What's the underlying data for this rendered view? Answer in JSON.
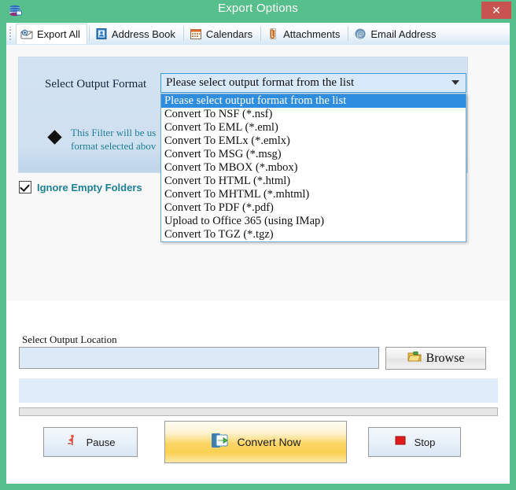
{
  "window": {
    "title": "Export Options",
    "app_icon": "database-stack-icon",
    "close_label": "✕",
    "titlebar_color": "#56bf8b",
    "close_button_color": "#c75450"
  },
  "tabs": [
    {
      "label": "Export All",
      "icon": "envelope-icon",
      "active": true
    },
    {
      "label": "Address Book",
      "icon": "contact-card-icon",
      "active": false
    },
    {
      "label": "Calendars",
      "icon": "calendar-icon",
      "active": false
    },
    {
      "label": "Attachments",
      "icon": "paperclip-icon",
      "active": false
    },
    {
      "label": "Email Address",
      "icon": "at-sign-icon",
      "active": false
    }
  ],
  "format_panel": {
    "label": "Select Output Format",
    "filter_note": "This Filter will be us format selected abov",
    "bullet_icon": "diamond-bullet-icon"
  },
  "combobox": {
    "value": "Please select output format from the list",
    "arrow_icon": "chevron-down-icon",
    "expanded": true,
    "selected_index": 0,
    "options": [
      "Please select output format from the list",
      "Convert To NSF (*.nsf)",
      "Convert To EML (*.eml)",
      "Convert To EMLx (*.emlx)",
      "Convert To MSG (*.msg)",
      "Convert To MBOX (*.mbox)",
      "Convert To HTML (*.html)",
      "Convert To MHTML (*.mhtml)",
      "Convert To PDF (*.pdf)",
      "Upload to Office 365 (using IMap)",
      "Convert To TGZ (*.tgz)"
    ],
    "highlight_color": "#2f8ddf"
  },
  "checkbox": {
    "label": "Ignore Empty Folders",
    "checked": true,
    "label_color": "#1d7f94"
  },
  "output_location": {
    "label": "Select Output Location",
    "value": "",
    "placeholder": "",
    "browse_label": "Browse",
    "browse_icon": "folder-open-icon"
  },
  "progress": {
    "status_text": "",
    "percent": 0
  },
  "actions": {
    "pause": {
      "label": "Pause",
      "icon": "pause-flag-icon"
    },
    "convert": {
      "label": "Convert Now",
      "icon": "export-arrow-icon"
    },
    "stop": {
      "label": "Stop",
      "icon": "stop-square-icon"
    }
  }
}
